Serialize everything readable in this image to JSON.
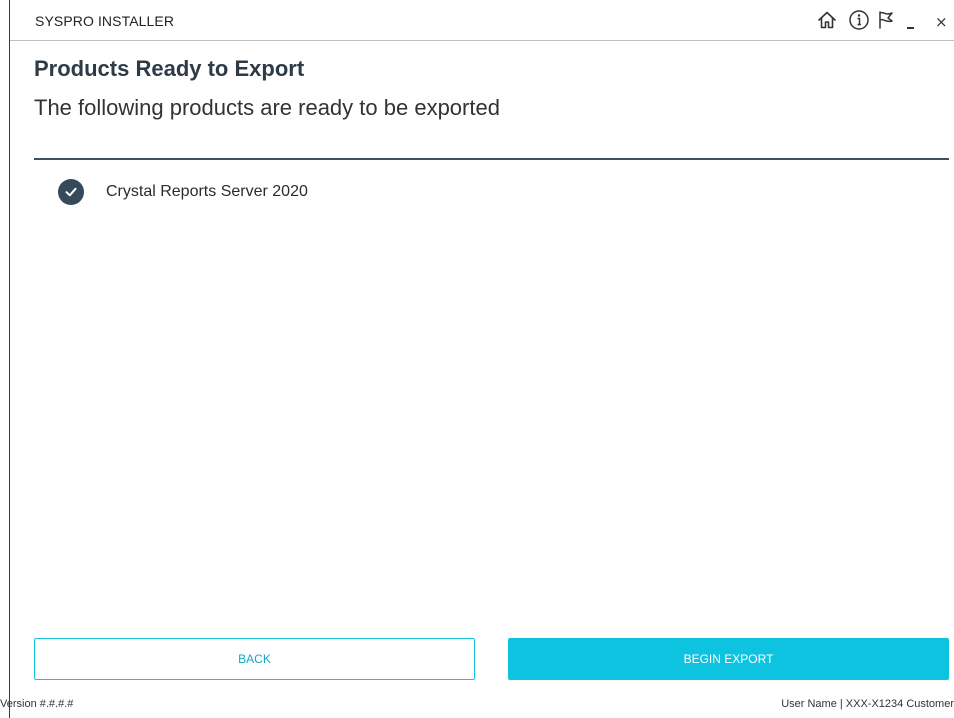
{
  "window": {
    "title": "SYSPRO INSTALLER"
  },
  "toolbar": {
    "icons": [
      "home-icon",
      "info-icon",
      "flag-icon",
      "minimize-icon",
      "close-icon"
    ],
    "close_glyph": "×"
  },
  "page": {
    "title": "Products Ready to Export",
    "subtitle": "The following products are ready to be exported"
  },
  "products": [
    {
      "label": "Crystal Reports Server 2020",
      "status": "checked"
    }
  ],
  "buttons": {
    "back_label": "BACK",
    "begin_export_label": "BEGIN EXPORT"
  },
  "footer": {
    "version": "Version #.#.#.#",
    "user": "User Name | XXX-X1234 Customer"
  },
  "colors": {
    "accent": "#0ec3e0",
    "check_bg": "#364a5c",
    "separator": "#3f4f5f"
  }
}
